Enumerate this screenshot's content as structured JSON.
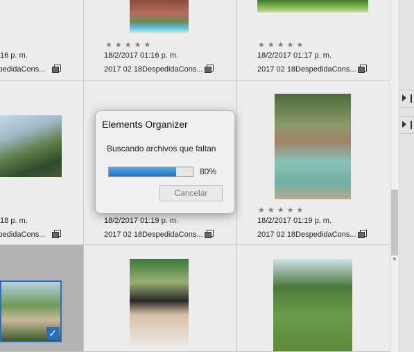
{
  "grid": {
    "rows": [
      {
        "cells": [
          {
            "stars": "",
            "date": "16 p. m.",
            "name": "spedidaCons..."
          },
          {
            "stars": "★★★★★",
            "date": "18/2/2017 01:16 p. m.",
            "name": "2017 02 18DespedidaCons..."
          },
          {
            "stars": "★★★★★",
            "date": "18/2/2017 01:17 p. m.",
            "name": "2017 02 18DespedidaCons..."
          }
        ]
      },
      {
        "cells": [
          {
            "stars": "",
            "date": "18 p. m.",
            "name": "spedidaCons..."
          },
          {
            "stars": "",
            "date": "18/2/2017 01:19 p. m.",
            "name": "2017 02 18DespedidaCons..."
          },
          {
            "stars": "★★★★★",
            "date": "18/2/2017 01:19 p. m.",
            "name": "2017 02 18DespedidaCons..."
          }
        ]
      }
    ]
  },
  "icons": {
    "stack": "stack-icon",
    "check": "checkmark-icon",
    "expand": "triangle-right-icon",
    "scroll_down": "chevron-down-icon"
  },
  "dialog": {
    "title": "Elements Organizer",
    "message": "Buscando archivos que faltan",
    "progress_percent": 80,
    "progress_label": "80%",
    "cancel_label": "Cancelar"
  },
  "colors": {
    "progress": "#1d74c8",
    "selection": "#2b6cc4"
  }
}
